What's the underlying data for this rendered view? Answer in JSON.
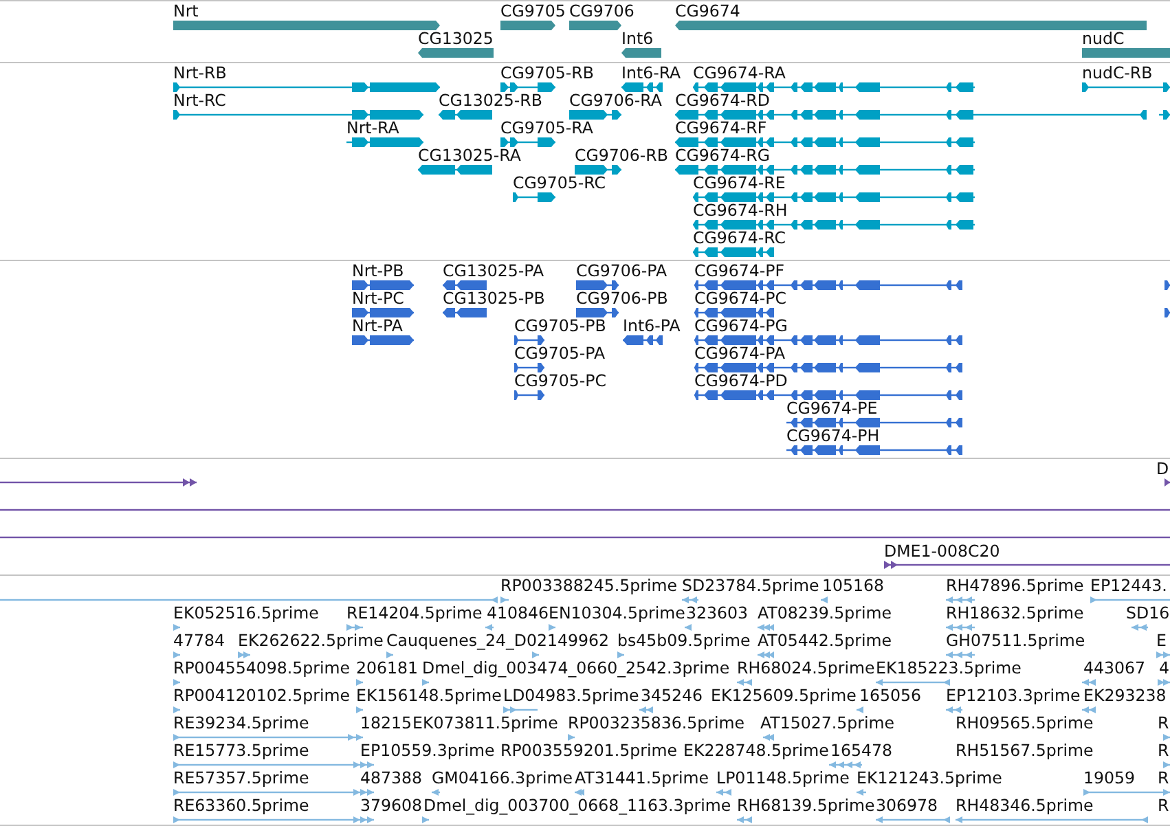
{
  "tracks": [
    {
      "kind": "gene",
      "features": [
        {
          "label": "Nrt",
          "reverse": false
        },
        {
          "label": "CG9705",
          "reverse": false
        },
        {
          "label": "CG9706",
          "reverse": false
        },
        {
          "label": "CG9674",
          "reverse": true
        },
        {
          "label": "CG13025",
          "reverse": true
        },
        {
          "label": "Int6",
          "reverse": true
        },
        {
          "label": "nudC"
        }
      ]
    },
    {
      "kind": "transcript",
      "features": [
        {
          "label": "Nrt-RB",
          "reverse": false
        },
        {
          "label": "CG9705-RB",
          "reverse": false
        },
        {
          "label": "Int6-RA",
          "reverse": true
        },
        {
          "label": "CG9674-RA",
          "reverse": true
        },
        {
          "label": "nudC-RB",
          "reverse": false
        },
        {
          "label": "Nrt-RC",
          "reverse": false
        },
        {
          "label": "CG13025-RB",
          "reverse": true
        },
        {
          "label": "CG9706-RA",
          "reverse": false
        },
        {
          "label": "CG9674-RD",
          "reverse": true
        },
        {
          "reverse": false
        },
        {
          "label": "Nrt-RA",
          "reverse": false
        },
        {
          "label": "CG9705-RA",
          "reverse": false
        },
        {
          "label": "CG9674-RF",
          "reverse": true
        },
        {
          "label": "CG13025-RA",
          "reverse": true
        },
        {
          "label": "CG9706-RB",
          "reverse": false
        },
        {
          "label": "CG9674-RG",
          "reverse": true
        },
        {
          "label": "CG9705-RC",
          "reverse": false
        },
        {
          "label": "CG9674-RE",
          "reverse": true
        },
        {
          "label": "CG9674-RH",
          "reverse": true
        },
        {
          "label": "CG9674-RC",
          "reverse": true
        }
      ]
    },
    {
      "kind": "protein",
      "features": [
        {
          "label": "Nrt-PB",
          "reverse": false
        },
        {
          "label": "CG13025-PA",
          "reverse": true
        },
        {
          "label": "CG9706-PA",
          "reverse": false
        },
        {
          "label": "CG9674-PF",
          "reverse": true
        },
        {
          "reverse": false
        },
        {
          "label": "Nrt-PC",
          "reverse": false
        },
        {
          "label": "CG13025-PB",
          "reverse": true
        },
        {
          "label": "CG9706-PB",
          "reverse": false
        },
        {
          "label": "CG9674-PC",
          "reverse": true
        },
        {
          "reverse": false
        },
        {
          "label": "Nrt-PA",
          "reverse": false
        },
        {
          "label": "CG9705-PB",
          "reverse": false
        },
        {
          "label": "Int6-PA",
          "reverse": true
        },
        {
          "label": "CG9674-PG",
          "reverse": true
        },
        {
          "label": "CG9705-PA",
          "reverse": false
        },
        {
          "label": "CG9674-PA",
          "reverse": true
        },
        {
          "label": "CG9705-PC",
          "reverse": false
        },
        {
          "label": "CG9674-PD",
          "reverse": true
        },
        {
          "label": "CG9674-PE",
          "reverse": true
        },
        {
          "label": "CG9674-PH",
          "reverse": true
        }
      ]
    },
    {
      "kind": "clone",
      "features": [
        {
          "kind": "arrowed",
          "reverse": false
        },
        {
          "kind": "arrowed",
          "label": "D",
          "reverse": false
        },
        {
          "kind": "line"
        },
        {
          "kind": "line"
        },
        {
          "kind": "arrowed",
          "label": "DME1-008C20",
          "reverse": false
        }
      ]
    },
    {
      "kind": "est",
      "features": [
        {
          "reverse": true
        },
        {
          "label": "RP003388245.5prime",
          "reverse": false
        },
        {
          "label": "SD23784.5prime",
          "reverse": true
        },
        {
          "label": "105168",
          "reverse": true
        },
        {
          "label": "RH47896.5prime",
          "reverse": true
        },
        {
          "label": "EP12443.",
          "reverse": false
        },
        {
          "label": "EK052516.5prime",
          "reverse": false
        },
        {
          "label": "RE14204.5prime",
          "reverse": false
        },
        {
          "label": "410846",
          "reverse": true
        },
        {
          "label": "EN10304.5prime",
          "reverse": false
        },
        {
          "label": "323603",
          "reverse": true
        },
        {
          "label": "AT08239.5prime",
          "reverse": true
        },
        {
          "label": "RH18632.5prime",
          "reverse": true
        },
        {
          "label": "SD16",
          "reverse": true
        },
        {
          "label": "47784",
          "reverse": false
        },
        {
          "label": "EK262622.5prime",
          "reverse": false
        },
        {
          "label": "Cauquenes_24_D02149962",
          "reverse": false
        },
        {
          "reverse": false
        },
        {
          "label": "bs45b09.5prime",
          "reverse": false
        },
        {
          "label": "AT05442.5prime",
          "reverse": true
        },
        {
          "label": "GH07511.5prime",
          "reverse": true
        },
        {
          "label": "E",
          "reverse": false
        },
        {
          "label": "RP004554098.5prime",
          "reverse": false
        },
        {
          "label": "206181",
          "reverse": false
        },
        {
          "label": "Dmel_dig_003474_0660_2542.3prime",
          "reverse": false
        },
        {
          "label": "RH68024.5prime",
          "reverse": true
        },
        {
          "label": "EK185223.5prime",
          "reverse": true
        },
        {
          "label": "443067",
          "reverse": true
        },
        {
          "label": "4",
          "reverse": false
        },
        {
          "label": "RP004120102.5prime",
          "reverse": false
        },
        {
          "label": "EK156148.5prime",
          "reverse": false
        },
        {
          "label": "LD04983.5prime",
          "reverse": false
        },
        {
          "label": "345246",
          "reverse": true
        },
        {
          "label": "EK125609.5prime"
        },
        {
          "label": "165056",
          "reverse": true
        },
        {
          "label": "EP12103.3prime",
          "reverse": true
        },
        {
          "label": "EK293238",
          "reverse": true
        },
        {
          "label": "RE39234.5prime",
          "reverse": false
        },
        {
          "label": "18215",
          "reverse": false
        },
        {
          "label": "EK073811.5prime"
        },
        {
          "label": "RP003235836.5prime",
          "reverse": false
        },
        {
          "label": "AT15027.5prime",
          "reverse": true
        },
        {
          "label": "RH09565.5prime"
        },
        {
          "label": "R",
          "reverse": false
        },
        {
          "label": "RE15773.5prime",
          "reverse": false
        },
        {
          "label": "EP10559.3prime"
        },
        {
          "label": "RP003559201.5prime"
        },
        {
          "label": "EK228748.5prime"
        },
        {
          "label": "165478",
          "reverse": true
        },
        {
          "label": "RH51567.5prime"
        },
        {
          "label": "R",
          "reverse": false
        },
        {
          "label": "RE57357.5prime",
          "reverse": false
        },
        {
          "label": "487388"
        },
        {
          "label": "GM04166.3prime",
          "reverse": true
        },
        {
          "label": "AT31441.5prime",
          "reverse": true
        },
        {
          "label": "LP01148.5prime",
          "reverse": true
        },
        {
          "label": "EK121243.5prime",
          "reverse": true
        },
        {
          "label": "19059",
          "reverse": false
        },
        {
          "label": "R"
        },
        {
          "label": "RE63360.5prime",
          "reverse": false
        },
        {
          "label": "379608"
        },
        {
          "label": "Dmel_dig_003700_0668_1163.3prime",
          "reverse": false
        },
        {
          "label": "RH68139.5prime",
          "reverse": true
        },
        {
          "label": "306978",
          "reverse": true
        },
        {
          "label": "RH48346.5prime",
          "reverse": true
        },
        {
          "label": "R"
        }
      ]
    }
  ]
}
